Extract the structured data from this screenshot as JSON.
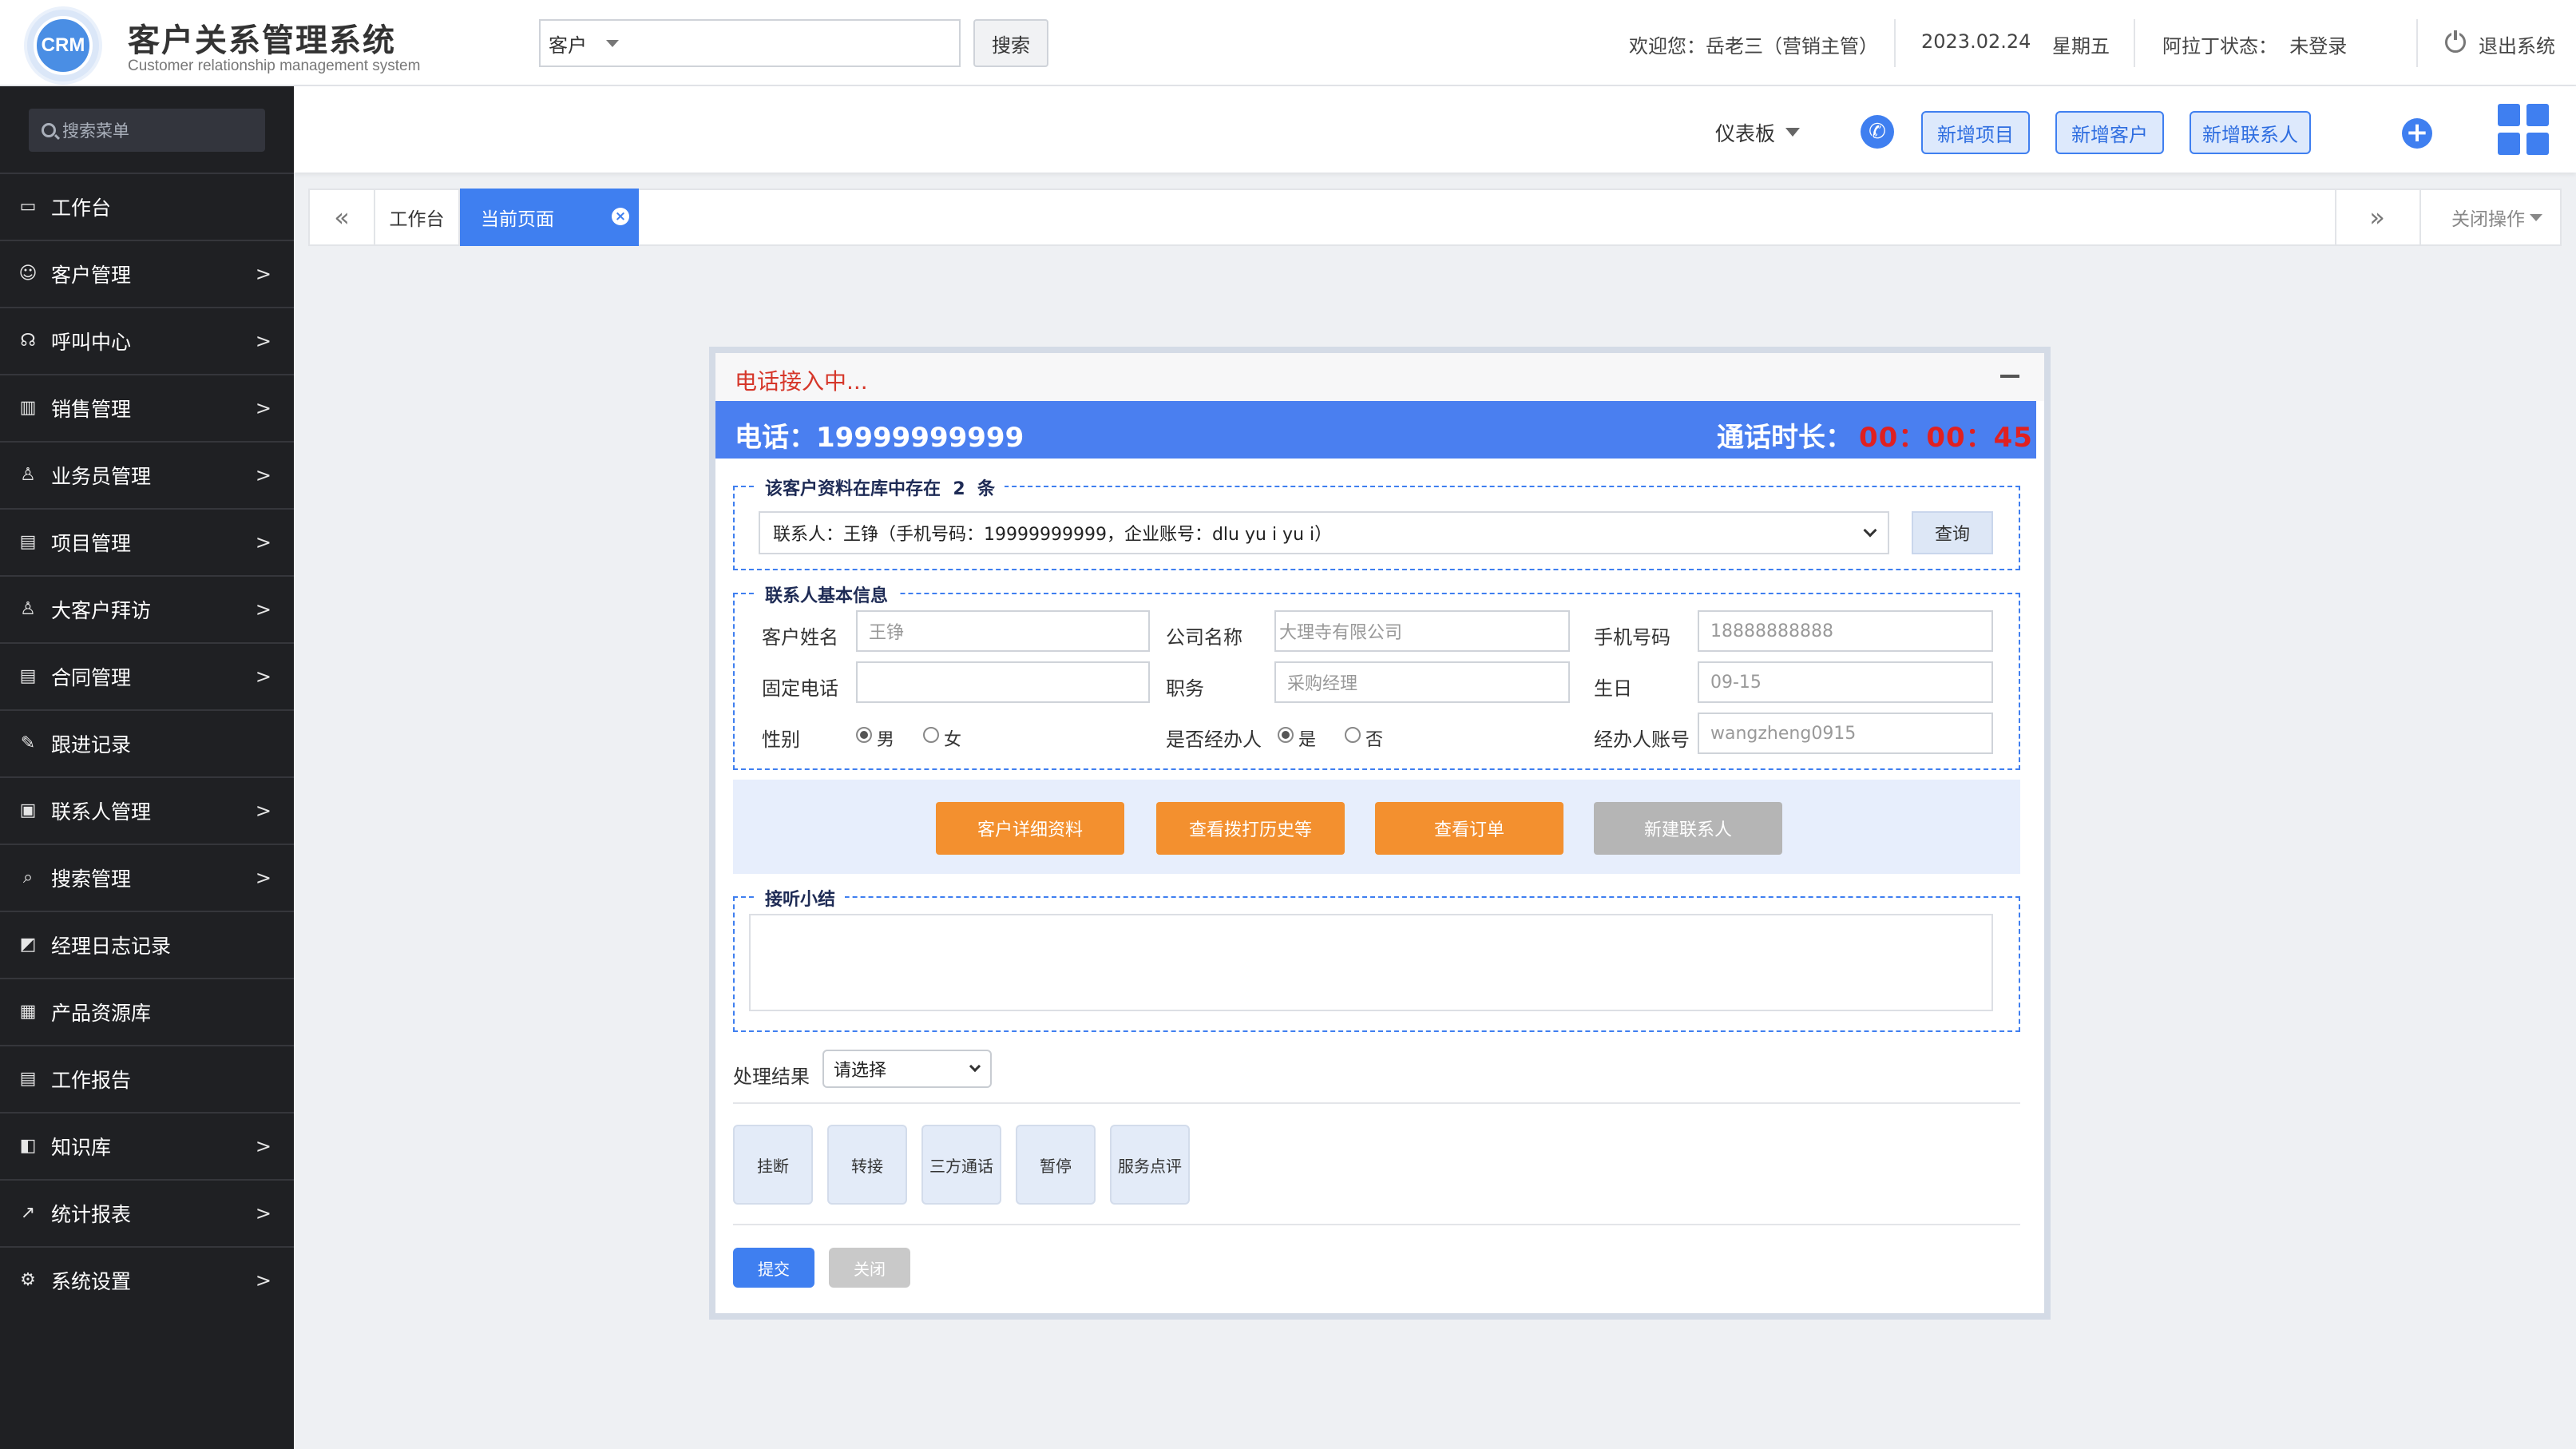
{
  "header": {
    "logo_text": "CRM",
    "title": "客户关系管理系统",
    "subtitle": "Customer relationship management system",
    "search_type": "客户",
    "search_value": "",
    "search_button": "搜索",
    "welcome": "欢迎您：岳老三（营销主管）",
    "date": "2023.02.24",
    "weekday": "星期五",
    "aladdin_status": "阿拉丁状态：  未登录",
    "logout": "退出系统"
  },
  "sidebar": {
    "search_placeholder": "搜索菜单",
    "items": [
      {
        "label": "工作台",
        "icon": "monitor-icon",
        "glyph": "▭",
        "has_arrow": false
      },
      {
        "label": "客户管理",
        "icon": "users-icon",
        "glyph": "☺",
        "has_arrow": true
      },
      {
        "label": "呼叫中心",
        "icon": "headset-icon",
        "glyph": "☊",
        "has_arrow": true
      },
      {
        "label": "销售管理",
        "icon": "bar-chart-icon",
        "glyph": "▥",
        "has_arrow": true
      },
      {
        "label": "业务员管理",
        "icon": "team-icon",
        "glyph": "♙",
        "has_arrow": true
      },
      {
        "label": "项目管理",
        "icon": "folder-icon",
        "glyph": "▤",
        "has_arrow": true
      },
      {
        "label": "大客户拜访",
        "icon": "user-visit-icon",
        "glyph": "♙",
        "has_arrow": true
      },
      {
        "label": "合同管理",
        "icon": "contract-icon",
        "glyph": "▤",
        "has_arrow": true
      },
      {
        "label": "跟进记录",
        "icon": "pencil-icon",
        "glyph": "✎",
        "has_arrow": false
      },
      {
        "label": "联系人管理",
        "icon": "contact-card-icon",
        "glyph": "▣",
        "has_arrow": true
      },
      {
        "label": "搜索管理",
        "icon": "search-icon",
        "glyph": "⌕",
        "has_arrow": true
      },
      {
        "label": "经理日志记录",
        "icon": "edit-square-icon",
        "glyph": "◩",
        "has_arrow": false
      },
      {
        "label": "产品资源库",
        "icon": "grid-icon",
        "glyph": "▦",
        "has_arrow": false
      },
      {
        "label": "工作报告",
        "icon": "report-icon",
        "glyph": "▤",
        "has_arrow": false
      },
      {
        "label": "知识库",
        "icon": "book-icon",
        "glyph": "◧",
        "has_arrow": true
      },
      {
        "label": "统计报表",
        "icon": "line-chart-icon",
        "glyph": "↗",
        "has_arrow": true
      },
      {
        "label": "系统设置",
        "icon": "gear-icon",
        "glyph": "⚙",
        "has_arrow": true
      }
    ]
  },
  "toolbar": {
    "dashboard": "仪表板",
    "buttons": [
      "新增项目",
      "新增客户",
      "新增联系人"
    ]
  },
  "tabs": {
    "work": "工作台",
    "current": "当前页面",
    "close_ops": "关闭操作"
  },
  "dialog": {
    "status": "电话接入中...",
    "phone": "电话：19999999999",
    "duration_label": "通话时长：",
    "duration": "00：00：45",
    "exist_legend": "该客户资料在库中存在  2  条",
    "exist_option": "联系人：王铮（手机号码：19999999999，企业账号：dlu yu i yu i）",
    "query_button": "查询",
    "basic_legend": "联系人基本信息",
    "fields": {
      "name_label": "客户姓名",
      "name_placeholder": "王铮",
      "company_label": "公司名称",
      "company_placeholder": "大理寺有限公司",
      "mobile_label": "手机号码",
      "mobile_placeholder": "18888888888",
      "landline_label": "固定电话",
      "landline_value": "",
      "position_label": "职务",
      "position_placeholder": "采购经理",
      "birthday_label": "生日",
      "birthday_placeholder": "09-15",
      "gender_label": "性别",
      "gender_male": "男",
      "gender_female": "女",
      "gender_selected": "男",
      "handler_label": "是否经办人",
      "handler_yes": "是",
      "handler_no": "否",
      "handler_selected": "是",
      "handler_account_label": "经办人账号",
      "handler_account_placeholder": "wangzheng0915"
    },
    "action_buttons": [
      "客户详细资料",
      "查看拨打历史等",
      "查看订单",
      "新建联系人"
    ],
    "summary_legend": "接听小结",
    "summary_value": "",
    "result_label": "处理结果",
    "result_value": "请选择",
    "call_buttons": [
      "挂断",
      "转接",
      "三方通话",
      "暂停",
      "服务点评"
    ],
    "submit": "提交",
    "close": "关闭"
  }
}
